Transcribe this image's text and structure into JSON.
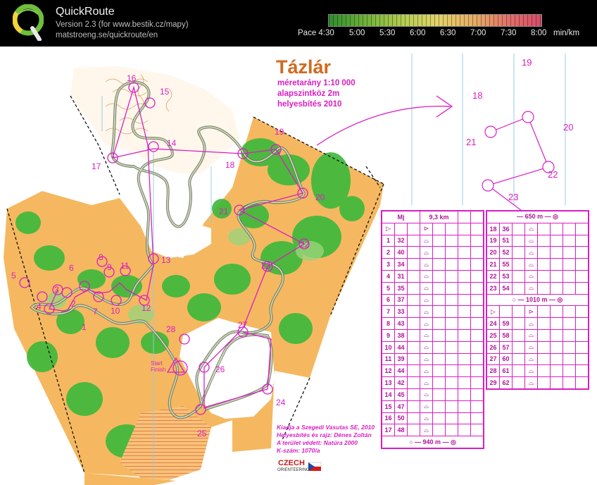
{
  "app": {
    "title": "QuickRoute",
    "version": "Version 2.3  (for www.bestik.cz/mapy)",
    "url": "matstroeng.se/quickroute/en"
  },
  "pace": {
    "label": "Pace 4:30",
    "ticks": [
      "5:00",
      "5:30",
      "6:00",
      "6:30",
      "7:00",
      "7:30",
      "8:00"
    ],
    "unit": "min/km"
  },
  "map": {
    "title": "Tázlár",
    "scale": "méretarány 1:10 000",
    "contour": "alapszintköz 2m",
    "updated": "helyesbítés 2010",
    "controls": [
      "1",
      "2",
      "3",
      "4",
      "5",
      "6",
      "7",
      "8",
      "9",
      "10",
      "11",
      "12",
      "13",
      "14",
      "15",
      "16",
      "17",
      "18",
      "19",
      "20",
      "21",
      "22",
      "23",
      "24",
      "25",
      "26",
      "27",
      "28"
    ],
    "inset_controls": [
      "18",
      "19",
      "20",
      "21",
      "22",
      "23"
    ],
    "start_finish": "Start Finish",
    "credits": [
      "Kiadja a Szegedi Vasutas SE, 2010",
      "Helyesbítés és rajz: Dénes Zoltán",
      "A terület védett: Natúra 2000",
      "K-szám: 1070/a"
    ],
    "brand": "CZECH",
    "brand_sub": "ORIENTEERING",
    "colors": {
      "magenta": "#d91ec2",
      "green": "#3bb83b",
      "orange": "#f5b860",
      "route": "#222222"
    }
  },
  "description": {
    "left_header": [
      "Mj",
      "9,3 km"
    ],
    "left_rows": [
      [
        "1",
        "32"
      ],
      [
        "2",
        "40"
      ],
      [
        "3",
        "34"
      ],
      [
        "4",
        "31"
      ],
      [
        "5",
        "35"
      ],
      [
        "6",
        "37"
      ],
      [
        "7",
        "33"
      ],
      [
        "8",
        "43"
      ],
      [
        "9",
        "38"
      ],
      [
        "10",
        "44"
      ],
      [
        "11",
        "39"
      ],
      [
        "12",
        "44"
      ],
      [
        "13",
        "42"
      ],
      [
        "14",
        "45"
      ],
      [
        "15",
        "47"
      ],
      [
        "16",
        "50"
      ],
      [
        "17",
        "48"
      ]
    ],
    "left_footer": "940 m",
    "right_top": "650 m",
    "right_rows_a": [
      [
        "18",
        "36"
      ],
      [
        "19",
        "51"
      ],
      [
        "20",
        "52"
      ],
      [
        "21",
        "55"
      ],
      [
        "22",
        "53"
      ],
      [
        "23",
        "54"
      ]
    ],
    "right_mid": "1010 m",
    "right_rows_b": [
      [
        "24",
        "59"
      ],
      [
        "25",
        "58"
      ],
      [
        "26",
        "57"
      ],
      [
        "27",
        "60"
      ],
      [
        "28",
        "61"
      ],
      [
        "29",
        "62"
      ]
    ]
  }
}
